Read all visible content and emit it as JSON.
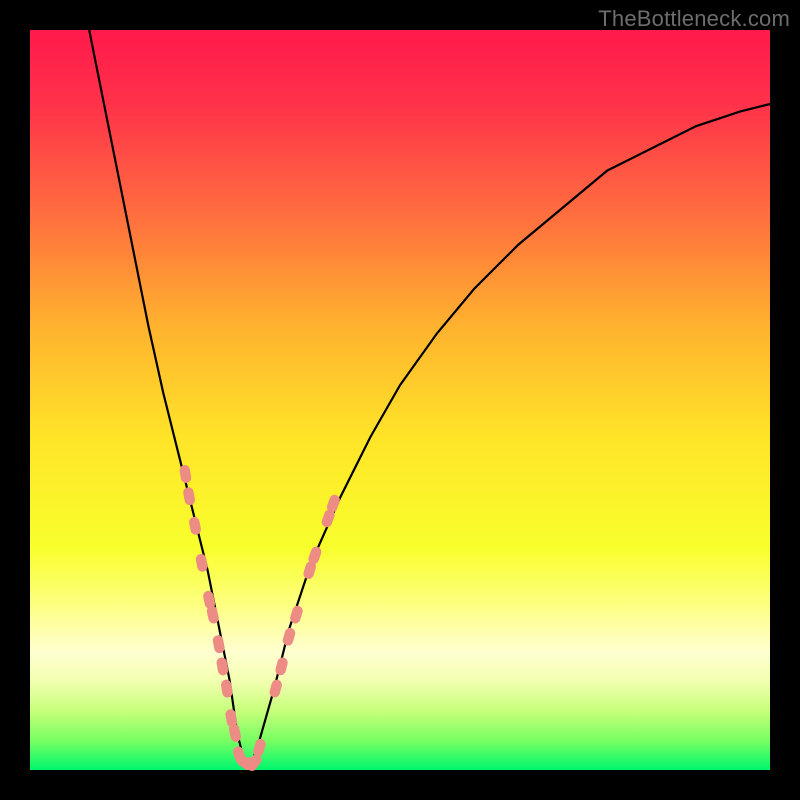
{
  "watermark": "TheBottleneck.com",
  "colors": {
    "frame": "#000000",
    "curve": "#000000",
    "markers_fill": "#ed8b85",
    "markers_stroke": "#ed8b85",
    "gradient_stops": [
      {
        "offset": 0.0,
        "color": "#ff1a4b"
      },
      {
        "offset": 0.1,
        "color": "#ff324a"
      },
      {
        "offset": 0.25,
        "color": "#ff6e3f"
      },
      {
        "offset": 0.4,
        "color": "#ffb22e"
      },
      {
        "offset": 0.55,
        "color": "#ffe428"
      },
      {
        "offset": 0.7,
        "color": "#f8ff2c"
      },
      {
        "offset": 0.78,
        "color": "#fdff84"
      },
      {
        "offset": 0.84,
        "color": "#ffffd0"
      },
      {
        "offset": 0.88,
        "color": "#f2ffb0"
      },
      {
        "offset": 0.92,
        "color": "#c7ff7a"
      },
      {
        "offset": 0.96,
        "color": "#78ff62"
      },
      {
        "offset": 1.0,
        "color": "#00f66e"
      }
    ]
  },
  "chart_data": {
    "type": "line",
    "title": "",
    "xlabel": "",
    "ylabel": "",
    "xlim": [
      0,
      100
    ],
    "ylim": [
      0,
      100
    ],
    "note": "x,y in % of plot area, origin at bottom-left. Curve is an asymmetric V (bottleneck). Values estimated from pixels.",
    "series": [
      {
        "name": "bottleneck-curve",
        "x": [
          8,
          10,
          12,
          14,
          16,
          18,
          20,
          22,
          23,
          24,
          25,
          26,
          27,
          28,
          29,
          30,
          31,
          33,
          35,
          38,
          42,
          46,
          50,
          55,
          60,
          66,
          72,
          78,
          84,
          90,
          96,
          100
        ],
        "y": [
          100,
          90,
          80,
          70,
          60,
          51,
          43,
          35,
          31,
          27,
          22,
          17,
          12,
          5,
          1,
          1,
          4,
          11,
          19,
          28,
          37,
          45,
          52,
          59,
          65,
          71,
          76,
          81,
          84,
          87,
          89,
          90
        ]
      }
    ],
    "markers": {
      "name": "data-points",
      "note": "pink capsule-shaped markers clustered near the bottom of the V on both sides",
      "points": [
        {
          "x": 21.0,
          "y": 40
        },
        {
          "x": 21.5,
          "y": 37
        },
        {
          "x": 22.3,
          "y": 33
        },
        {
          "x": 23.2,
          "y": 28
        },
        {
          "x": 24.2,
          "y": 23
        },
        {
          "x": 24.7,
          "y": 21
        },
        {
          "x": 25.5,
          "y": 17
        },
        {
          "x": 26.0,
          "y": 14
        },
        {
          "x": 26.6,
          "y": 11
        },
        {
          "x": 27.2,
          "y": 7
        },
        {
          "x": 27.7,
          "y": 5
        },
        {
          "x": 28.3,
          "y": 2
        },
        {
          "x": 29.0,
          "y": 1
        },
        {
          "x": 29.6,
          "y": 1
        },
        {
          "x": 30.3,
          "y": 1
        },
        {
          "x": 31.0,
          "y": 3
        },
        {
          "x": 33.2,
          "y": 11
        },
        {
          "x": 34.0,
          "y": 14
        },
        {
          "x": 35.0,
          "y": 18
        },
        {
          "x": 36.0,
          "y": 21
        },
        {
          "x": 37.8,
          "y": 27
        },
        {
          "x": 38.5,
          "y": 29
        },
        {
          "x": 40.3,
          "y": 34
        },
        {
          "x": 41.0,
          "y": 36
        }
      ]
    }
  }
}
